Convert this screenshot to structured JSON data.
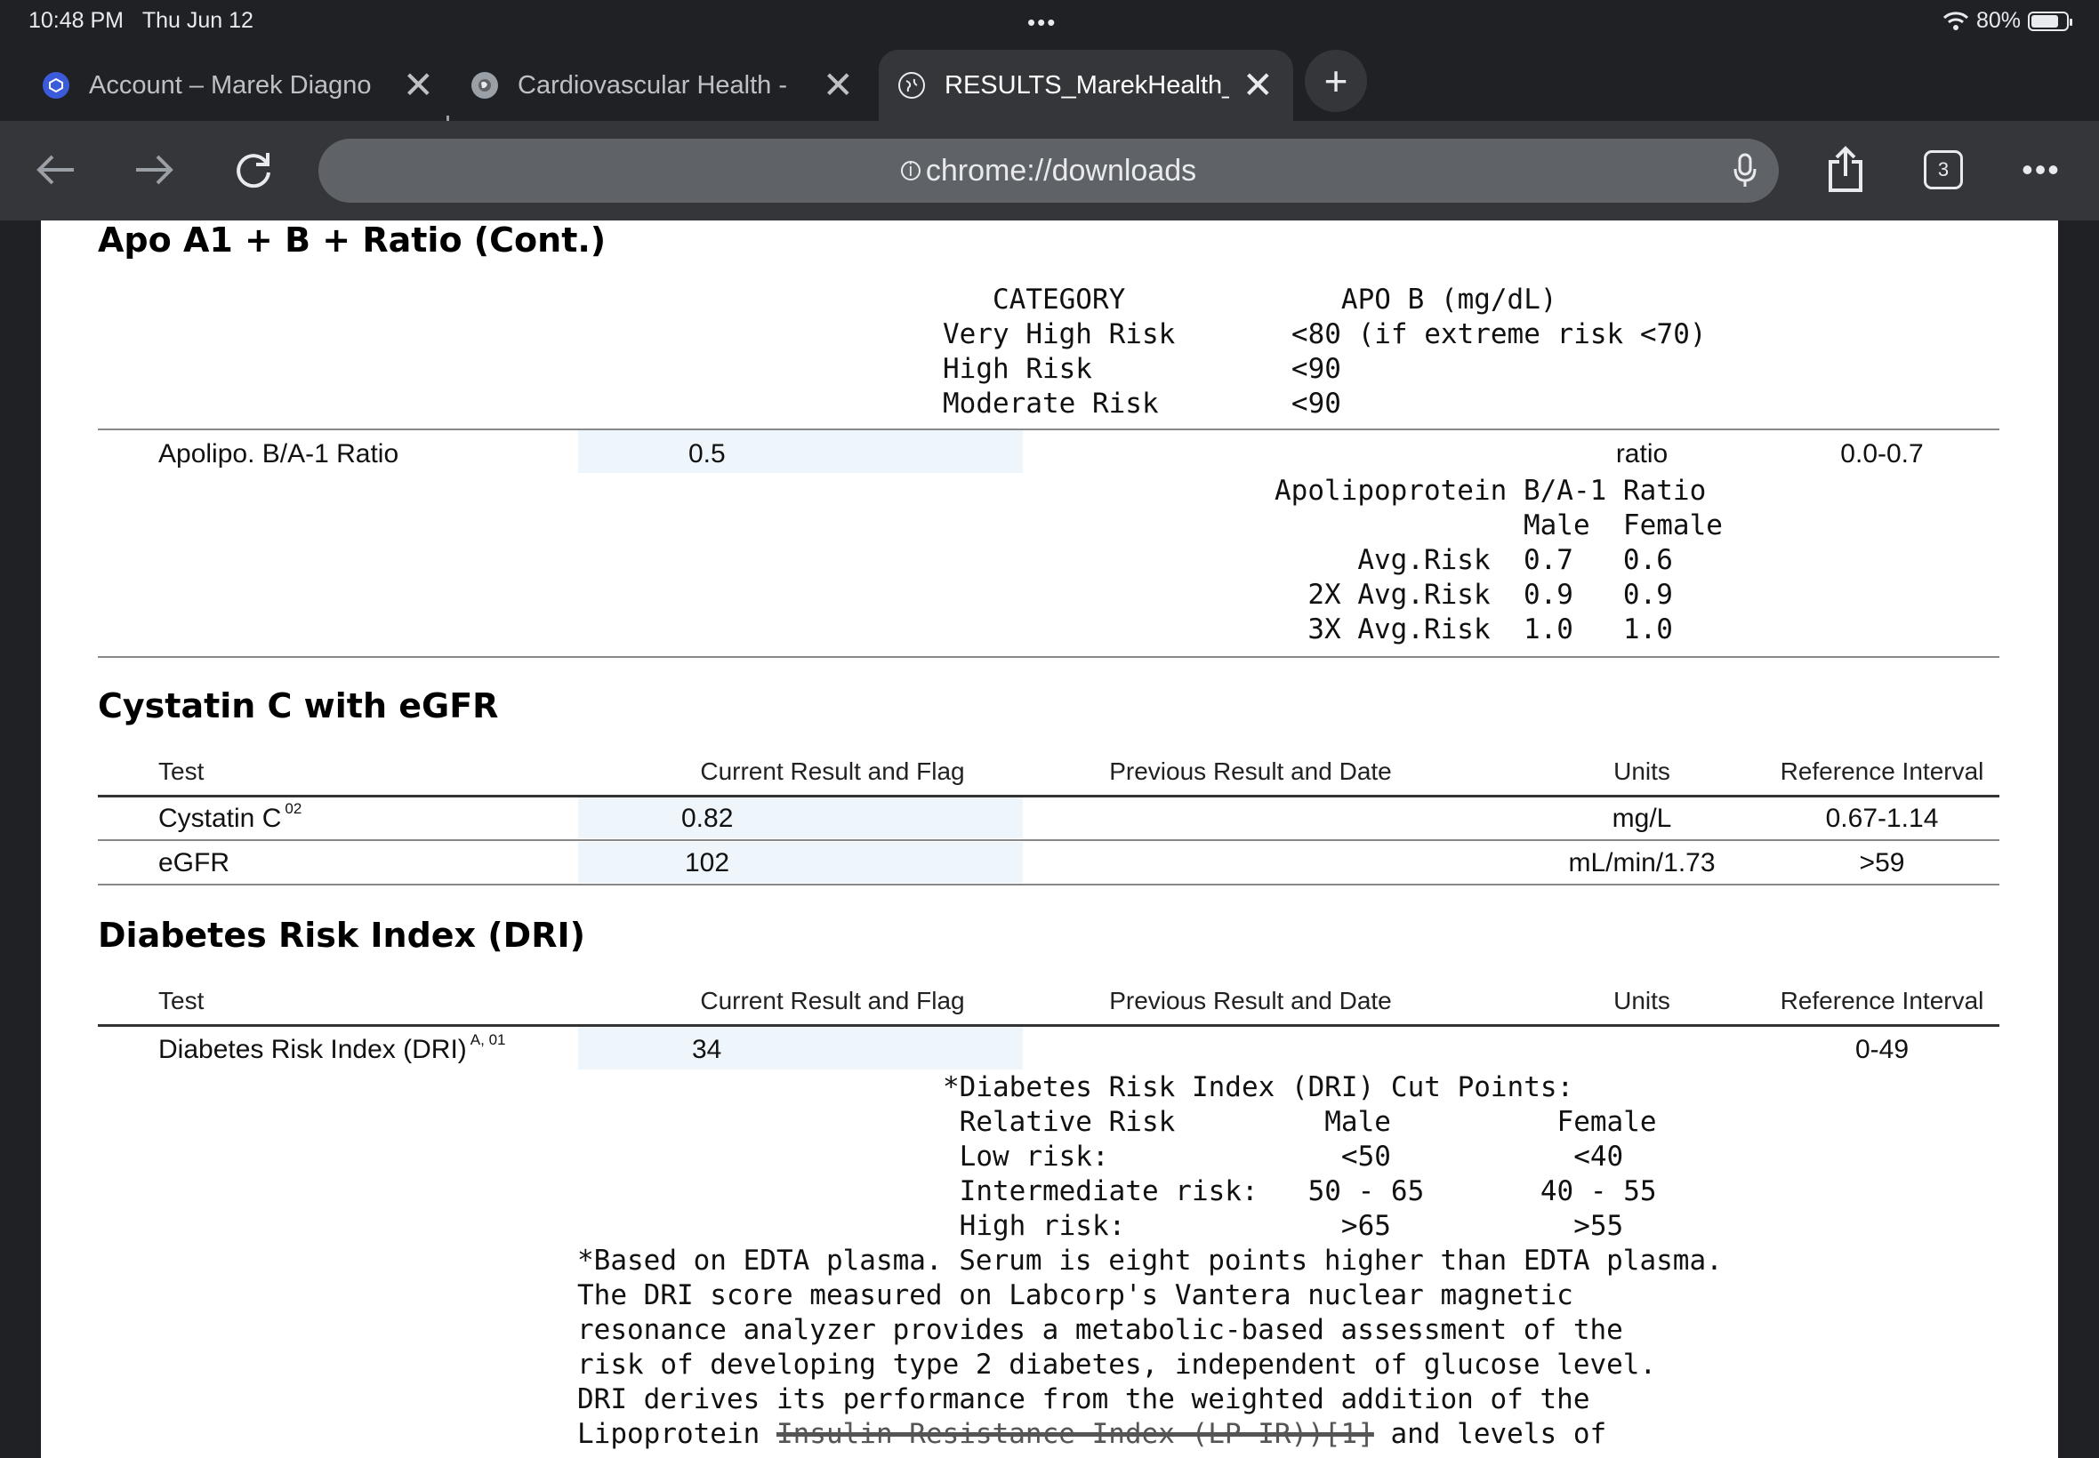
{
  "status_bar": {
    "time": "10:48 PM",
    "date": "Thu Jun 12",
    "battery": "80%",
    "battery_level": 0.8
  },
  "tabs": [
    {
      "title": "Account – Marek Diagno",
      "favicon": "marek-icon"
    },
    {
      "title": "Cardiovascular Health -",
      "favicon": "site-icon"
    },
    {
      "title": "RESULTS_MarekHealth_",
      "favicon": "globe-icon",
      "active": true
    }
  ],
  "toolbar": {
    "url": "chrome://downloads",
    "tab_count": "3"
  },
  "apo": {
    "heading": "Apo A1 + B + Ratio (Cont.)",
    "category_table": "   CATEGORY             APO B (mg/dL)\nVery High Risk       <80 (if extreme risk <70)\nHigh Risk            <90\nModerate Risk        <90",
    "ratio_row": {
      "test": "Apolipo. B/A-1 Ratio",
      "result": "0.5",
      "units": "ratio",
      "reference": "0.0-0.7"
    },
    "ratio_table": "Apolipoprotein B/A-1 Ratio\n               Male  Female\n     Avg.Risk  0.7   0.6\n  2X Avg.Risk  0.9   0.9\n  3X Avg.Risk  1.0   1.0"
  },
  "columns": {
    "test": "Test",
    "current": "Current Result and Flag",
    "previous": "Previous Result and Date",
    "units": "Units",
    "reference": "Reference Interval"
  },
  "cystatin": {
    "heading": "Cystatin C with eGFR",
    "rows": [
      {
        "test": "Cystatin C",
        "sup": "02",
        "result": "0.82",
        "units": "mg/L",
        "reference": "0.67-1.14"
      },
      {
        "test": "eGFR",
        "sup": "",
        "result": "102",
        "units": "mL/min/1.73",
        "reference": ">59"
      }
    ]
  },
  "dri": {
    "heading": "Diabetes Risk Index (DRI)",
    "row": {
      "test": "Diabetes Risk Index (DRI)",
      "sup": "A, 01",
      "result": "34",
      "reference": "0-49"
    },
    "cut_points": "*Diabetes Risk Index (DRI) Cut Points:\n Relative Risk         Male          Female\n Low risk:              <50           <40\n Intermediate risk:   50 - 65       40 - 55\n High risk:             >65           >55",
    "note": "*Based on EDTA plasma. Serum is eight points higher than EDTA plasma.\nThe DRI score measured on Labcorp's Vantera nuclear magnetic\nresonance analyzer provides a metabolic-based assessment of the\nrisk of developing type 2 diabetes, independent of glucose level.\nDRI derives its performance from the weighted addition of the",
    "note_last_prefix": "Lipoprotein ",
    "note_last_struck": "Insulin Resistance Index (LP-IR))[1]",
    "note_last_suffix": " and levels of"
  }
}
